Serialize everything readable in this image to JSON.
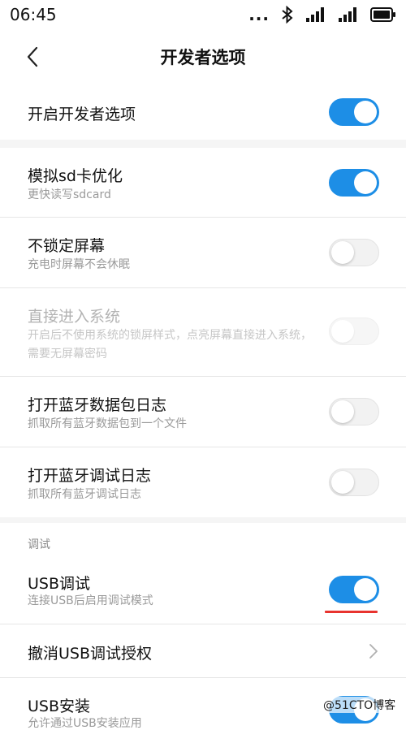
{
  "status_bar": {
    "time": "06:45",
    "dots": "..."
  },
  "header": {
    "title": "开发者选项"
  },
  "top_toggle": {
    "label": "开启开发者选项",
    "state": "on"
  },
  "rows": [
    {
      "title": "模拟sd卡优化",
      "subtitle": "更快读写sdcard",
      "state": "on"
    },
    {
      "title": "不锁定屏幕",
      "subtitle": "充电时屏幕不会休眠",
      "state": "off"
    },
    {
      "title": "直接进入系统",
      "subtitle": "开启后不使用系统的锁屏样式，点亮屏幕直接进入系统，需要无屏幕密码",
      "state": "off",
      "disabled": true
    },
    {
      "title": "打开蓝牙数据包日志",
      "subtitle": "抓取所有蓝牙数据包到一个文件",
      "state": "off"
    },
    {
      "title": "打开蓝牙调试日志",
      "subtitle": "抓取所有蓝牙调试日志",
      "state": "off"
    }
  ],
  "debug_section": {
    "header": "调试",
    "usb_debugging": {
      "title": "USB调试",
      "subtitle": "连接USB后启用调试模式",
      "state": "on"
    },
    "revoke": {
      "title": "撤消USB调试授权"
    },
    "usb_install": {
      "title": "USB安装",
      "subtitle": "允许通过USB安装应用",
      "state": "on"
    }
  },
  "watermark": "@51CTO博客",
  "colors": {
    "switch_on": "#1d8ee6",
    "annotation_red": "#e8332e",
    "divider": "#e6e6e6"
  }
}
